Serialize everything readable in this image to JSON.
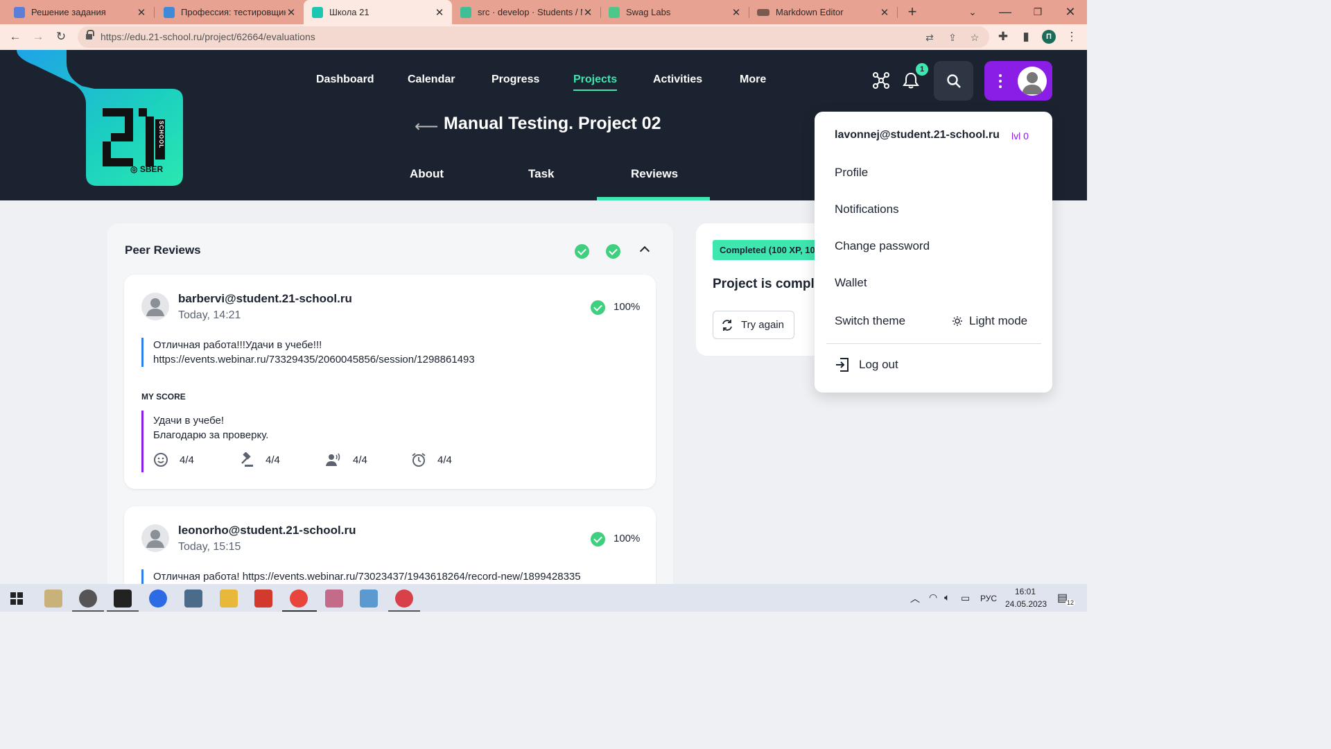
{
  "browser": {
    "tabs": [
      {
        "title": "Решение задания",
        "active": false
      },
      {
        "title": "Профессия: тестировщик",
        "active": false
      },
      {
        "title": "Школа 21",
        "active": true
      },
      {
        "title": "src · develop · Students / M",
        "active": false
      },
      {
        "title": "Swag Labs",
        "active": false
      },
      {
        "title": "Markdown Editor",
        "active": false
      }
    ],
    "url": "https://edu.21-school.ru/project/62664/evaluations",
    "profile_initial": "П"
  },
  "site": {
    "logo": {
      "number": "21",
      "school": "SCHOOL",
      "brand": "SBER"
    },
    "nav": [
      "Dashboard",
      "Calendar",
      "Progress",
      "Projects",
      "Activities",
      "More"
    ],
    "active_nav": "Projects",
    "notification_count": "1",
    "page_title": "Manual Testing. Project 02",
    "subtabs": [
      "About",
      "Task",
      "Reviews"
    ],
    "active_subtab": "Reviews"
  },
  "peer_reviews": {
    "title": "Peer Reviews",
    "reviews": [
      {
        "user": "barbervi@student.21-school.ru",
        "time": "Today, 14:21",
        "percent": "100%",
        "comment_line1": "Отличная работа!!!Удачи в учебе!!!",
        "comment_line2": "https://events.webinar.ru/73329435/2060045856/session/1298861493",
        "my_score_label": "MY SCORE",
        "my_score_line1": "Удачи в учебе!",
        "my_score_line2": "Благодарю за проверку.",
        "scores": [
          "4/4",
          "4/4",
          "4/4",
          "4/4"
        ]
      },
      {
        "user": "leonorho@student.21-school.ru",
        "time": "Today, 15:15",
        "percent": "100%",
        "comment_line1": "Отличная работа! https://events.webinar.ru/73023437/1943618264/record-new/1899428335"
      }
    ]
  },
  "status_card": {
    "badge": "Completed (100 XP, 10",
    "heading": "Project is comple",
    "try_again": "Try again"
  },
  "user_menu": {
    "email": "lavonnej@student.21-school.ru",
    "level": "lvl 0",
    "items": [
      "Profile",
      "Notifications",
      "Change password",
      "Wallet"
    ],
    "switch_theme": "Switch theme",
    "theme_value": "Light mode",
    "logout": "Log out"
  },
  "taskbar": {
    "lang": "РУС",
    "time": "16:01",
    "date": "24.05.2023",
    "notif_count": "12"
  },
  "colors": {
    "accent_green": "#3ee6b0",
    "accent_purple": "#8a1ee6",
    "header_bg": "#1c2330",
    "tabbar_bg": "#e8a291"
  }
}
